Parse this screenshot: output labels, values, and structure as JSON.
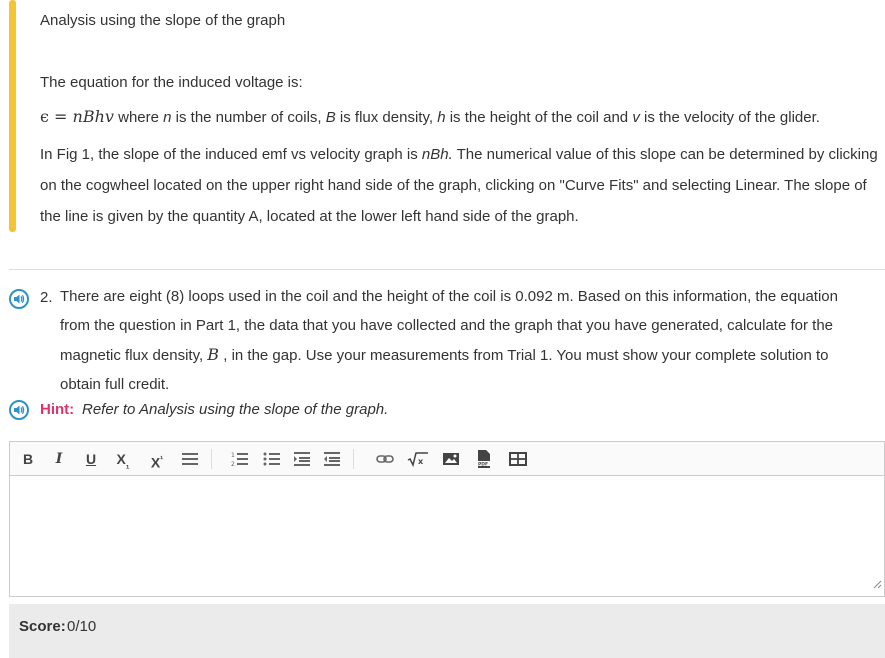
{
  "analysis": {
    "heading": "Analysis using the slope of the graph",
    "equation_intro": "The equation for the induced voltage is:",
    "equation": {
      "epsilon": "ϵ",
      "equals": " = ",
      "rhs": "nBhv",
      "t1": " where ",
      "n": "n",
      "t2": " is the number of coils, ",
      "B": "B",
      "t3": " is flux density, ",
      "h": "h",
      "t4": " is the height of the coil and ",
      "v": "v",
      "t5": " is the velocity of the glider."
    },
    "body": {
      "t1": "In Fig 1,  the slope of the induced emf vs velocity graph is ",
      "nbh": "nBh.",
      "t2": " The numerical value of this slope can be determined by clicking on the cogwheel located on the upper right hand side of the graph, clicking on \"Curve Fits\" and selecting Linear. The slope of the line is given by the quantity A, located at the lower left hand side of the graph."
    }
  },
  "question": {
    "number": "2.",
    "t1": "There are eight (8) loops used in the coil and the height of the coil is 0.092 m. Based on this information, the equation from the question in Part 1, the data that you have collected and the graph that you have generated, calculate for the magnetic flux density, ",
    "B": "B",
    "t2": " , in the gap. Use your measurements from Trial 1. You must show your complete solution to obtain full credit."
  },
  "hint": {
    "label": "Hint:",
    "text": "Refer to Analysis using the slope of the graph."
  },
  "toolbar": {
    "bold": "B",
    "italic": "I",
    "underline": "U",
    "subscript": "X",
    "subscript_mark": "₁",
    "superscript": "X",
    "superscript_mark": "¹",
    "icons": [
      "align-icon",
      "ordered-list-icon",
      "bullet-list-icon",
      "indent-icon",
      "outdent-icon",
      "link-icon",
      "equation-icon",
      "image-icon",
      "pdf-icon",
      "table-icon"
    ]
  },
  "score": {
    "label": "Score:",
    "value": "0/10"
  },
  "colors": {
    "accent_bar": "#f3c433",
    "hint": "#e0336e",
    "speaker": "#2f91c8"
  }
}
